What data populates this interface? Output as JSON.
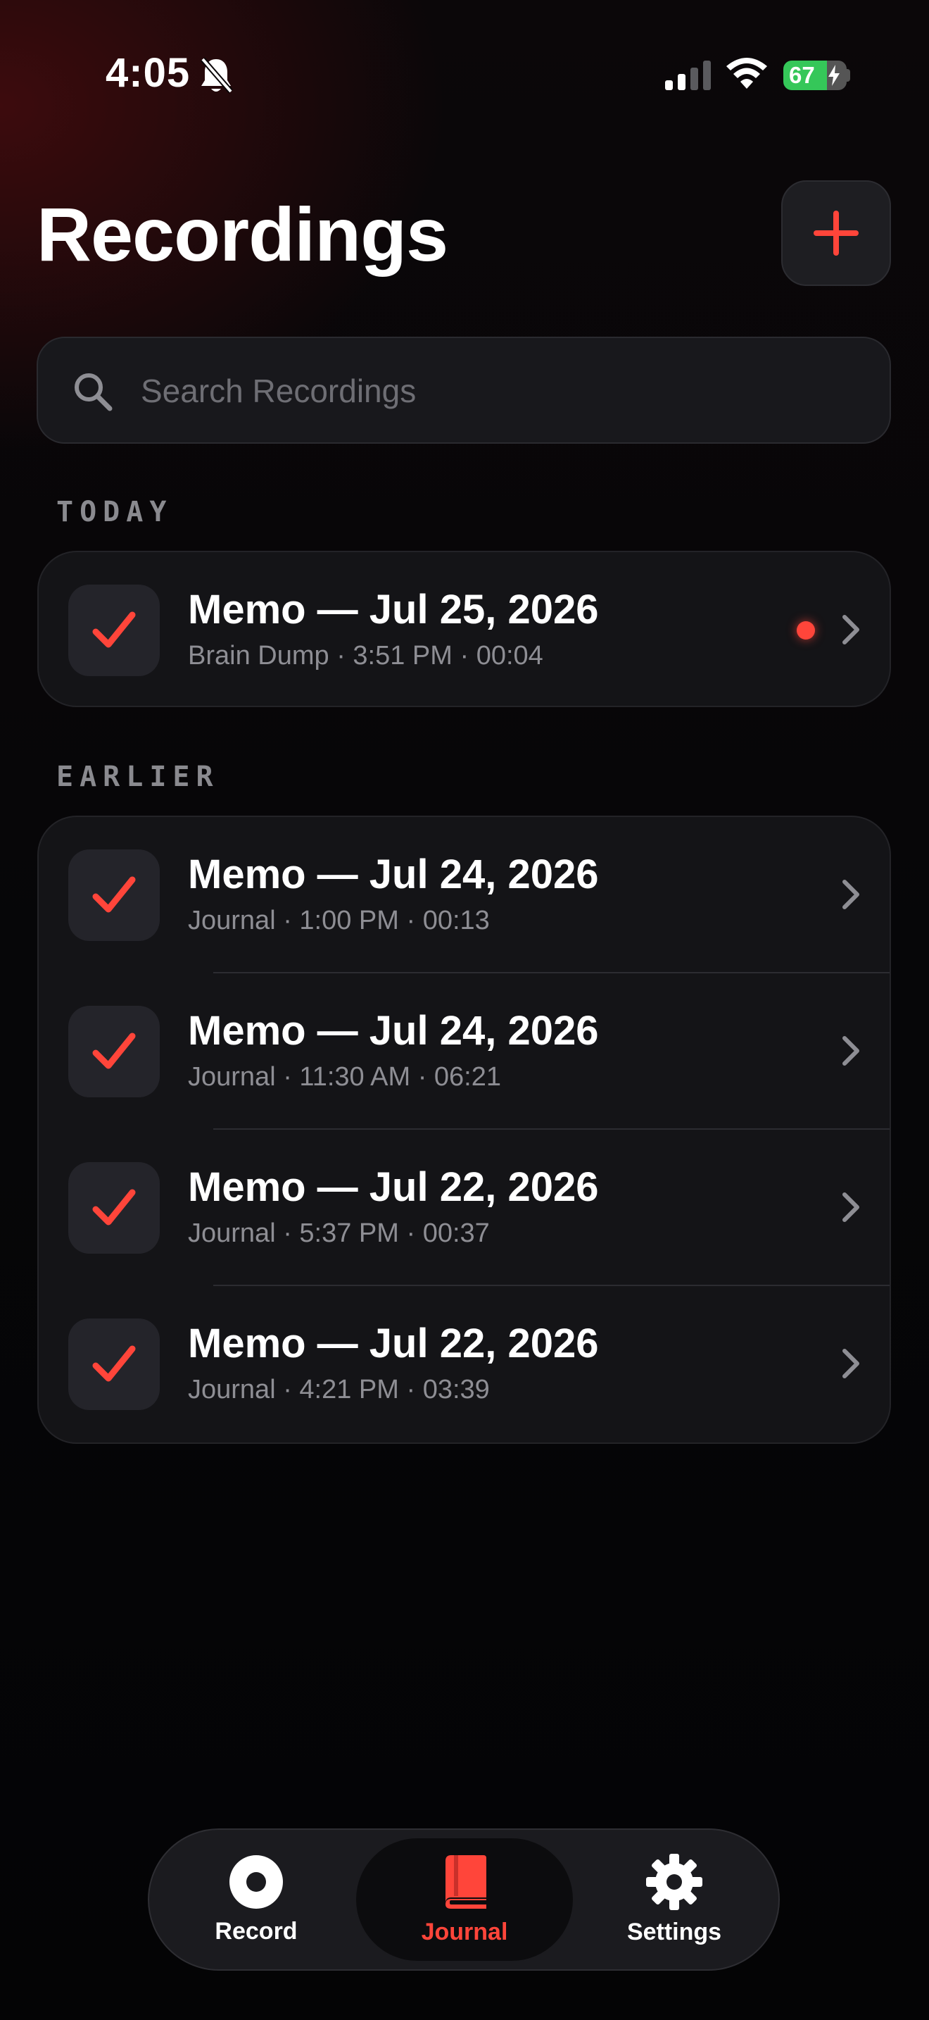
{
  "status_bar": {
    "time": "4:05",
    "battery": "67",
    "icons": [
      "bell-slash-icon",
      "cellular-signal-icon",
      "wifi-icon",
      "battery-charging-icon"
    ]
  },
  "header": {
    "title": "Recordings",
    "add_icon": "plus-icon"
  },
  "search": {
    "placeholder": "Search Recordings",
    "value": ""
  },
  "sections": {
    "today": {
      "label": "TODAY",
      "items": [
        {
          "title": "Memo — Jul 25, 2026",
          "subtitle": "Brain Dump · 3:51 PM · 00:04",
          "indicator": "red-dot"
        }
      ]
    },
    "earlier": {
      "label": "EARLIER",
      "items": [
        {
          "title": "Memo — Jul 24, 2026",
          "subtitle": "Journal · 1:00 PM · 00:13"
        },
        {
          "title": "Memo — Jul 24, 2026",
          "subtitle": "Journal · 11:30 AM · 06:21"
        },
        {
          "title": "Memo — Jul 22, 2026",
          "subtitle": "Journal · 5:37 PM · 00:37"
        },
        {
          "title": "Memo — Jul 22, 2026",
          "subtitle": "Journal · 4:21 PM · 03:39"
        }
      ]
    }
  },
  "tabbar": {
    "tabs": [
      {
        "label": "Record",
        "icon": "record-icon"
      },
      {
        "label": "Journal",
        "icon": "book-icon",
        "active": true
      },
      {
        "label": "Settings",
        "icon": "gear-icon"
      }
    ]
  },
  "colors": {
    "accent": "#ff453a",
    "background": "#050507",
    "card": "#141417",
    "battery": "#35c759"
  }
}
